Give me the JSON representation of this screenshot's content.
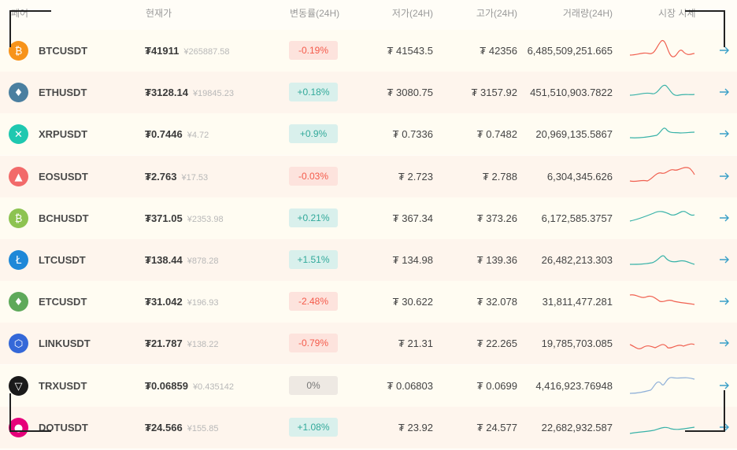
{
  "header": {
    "pair": "페어",
    "price": "현재가",
    "change": "변동률(24H)",
    "low": "저가(24H)",
    "high": "고가(24H)",
    "volume": "거래량(24H)",
    "trend": "시장 시세"
  },
  "rows": [
    {
      "symbol": "BTCUSDT",
      "price": "₮41911",
      "cny": "¥265887.58",
      "change": "-0.19%",
      "dir": "down",
      "low": "₮ 41543.5",
      "high": "₮ 42356",
      "volume": "6,485,509,251.665",
      "icon": "bitcoin-icon",
      "color": "#f7931a",
      "sparkColor": "#f06050"
    },
    {
      "symbol": "ETHUSDT",
      "price": "₮3128.14",
      "cny": "¥19845.23",
      "change": "+0.18%",
      "dir": "up",
      "low": "₮ 3080.75",
      "high": "₮ 3157.92",
      "volume": "451,510,903.7822",
      "icon": "ethereum-icon",
      "color": "#4a7fa0",
      "sparkColor": "#38b2a8"
    },
    {
      "symbol": "XRPUSDT",
      "price": "₮0.7446",
      "cny": "¥4.72",
      "change": "+0.9%",
      "dir": "up",
      "low": "₮ 0.7336",
      "high": "₮ 0.7482",
      "volume": "20,969,135.5867",
      "icon": "ripple-icon",
      "color": "#1fc8b0",
      "sparkColor": "#38b2a8"
    },
    {
      "symbol": "EOSUSDT",
      "price": "₮2.763",
      "cny": "¥17.53",
      "change": "-0.03%",
      "dir": "down",
      "low": "₮ 2.723",
      "high": "₮ 2.788",
      "volume": "6,304,345.626",
      "icon": "eos-icon",
      "color": "#f26a6a",
      "sparkColor": "#f06050"
    },
    {
      "symbol": "BCHUSDT",
      "price": "₮371.05",
      "cny": "¥2353.98",
      "change": "+0.21%",
      "dir": "up",
      "low": "₮ 367.34",
      "high": "₮ 373.26",
      "volume": "6,172,585.3757",
      "icon": "bitcoin-cash-icon",
      "color": "#8dc351",
      "sparkColor": "#38b2a8"
    },
    {
      "symbol": "LTCUSDT",
      "price": "₮138.44",
      "cny": "¥878.28",
      "change": "+1.51%",
      "dir": "up",
      "low": "₮ 134.98",
      "high": "₮ 139.36",
      "volume": "26,482,213.303",
      "icon": "litecoin-icon",
      "color": "#1e88d8",
      "sparkColor": "#38b2a8"
    },
    {
      "symbol": "ETCUSDT",
      "price": "₮31.042",
      "cny": "¥196.93",
      "change": "-2.48%",
      "dir": "down",
      "low": "₮ 30.622",
      "high": "₮ 32.078",
      "volume": "31,811,477.281",
      "icon": "ethereum-classic-icon",
      "color": "#5ea95a",
      "sparkColor": "#f06050"
    },
    {
      "symbol": "LINKUSDT",
      "price": "₮21.787",
      "cny": "¥138.22",
      "change": "-0.79%",
      "dir": "down",
      "low": "₮ 21.31",
      "high": "₮ 22.265",
      "volume": "19,785,703.085",
      "icon": "chainlink-icon",
      "color": "#3468d8",
      "sparkColor": "#f06050"
    },
    {
      "symbol": "TRXUSDT",
      "price": "₮0.06859",
      "cny": "¥0.435142",
      "change": "0%",
      "dir": "flat",
      "low": "₮ 0.06803",
      "high": "₮ 0.0699",
      "volume": "4,416,923.76948",
      "icon": "tron-icon",
      "color": "#1a1a1a",
      "sparkColor": "#8fb0d8"
    },
    {
      "symbol": "DOTUSDT",
      "price": "₮24.566",
      "cny": "¥155.85",
      "change": "+1.08%",
      "dir": "up",
      "low": "₮ 23.92",
      "high": "₮ 24.577",
      "volume": "22,682,932.587",
      "icon": "polkadot-icon",
      "color": "#e6007a",
      "sparkColor": "#38b2a8"
    }
  ],
  "colors": {
    "up": "#31a99a",
    "down": "#f45a4a",
    "arrow": "#3aa0c8"
  }
}
